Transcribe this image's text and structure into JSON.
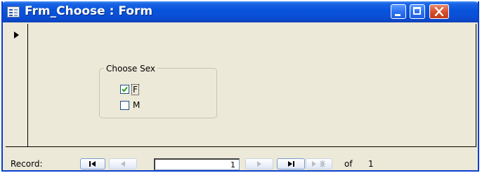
{
  "window": {
    "title": "Frm_Choose : Form",
    "icon": "form-icon",
    "controls": [
      "minimize-icon",
      "maximize-icon",
      "close-icon"
    ]
  },
  "form": {
    "record_selector_icon": "current-record-arrow-icon",
    "option_group": {
      "label": "Choose Sex",
      "options": [
        {
          "label": "F",
          "checked": true,
          "focused": true
        },
        {
          "label": "M",
          "checked": false,
          "focused": false
        }
      ]
    }
  },
  "navigation": {
    "record_label": "Record:",
    "current_record": "1",
    "of_label": "of",
    "total_records": "1",
    "buttons": [
      "first-record-icon",
      "previous-record-icon",
      "next-record-icon",
      "last-record-icon",
      "new-record-icon"
    ]
  },
  "colors": {
    "title_bar": "#0a4fd6",
    "window_bg": "#ece9d8",
    "close_button": "#d8512e",
    "check_mark": "#21a121"
  }
}
